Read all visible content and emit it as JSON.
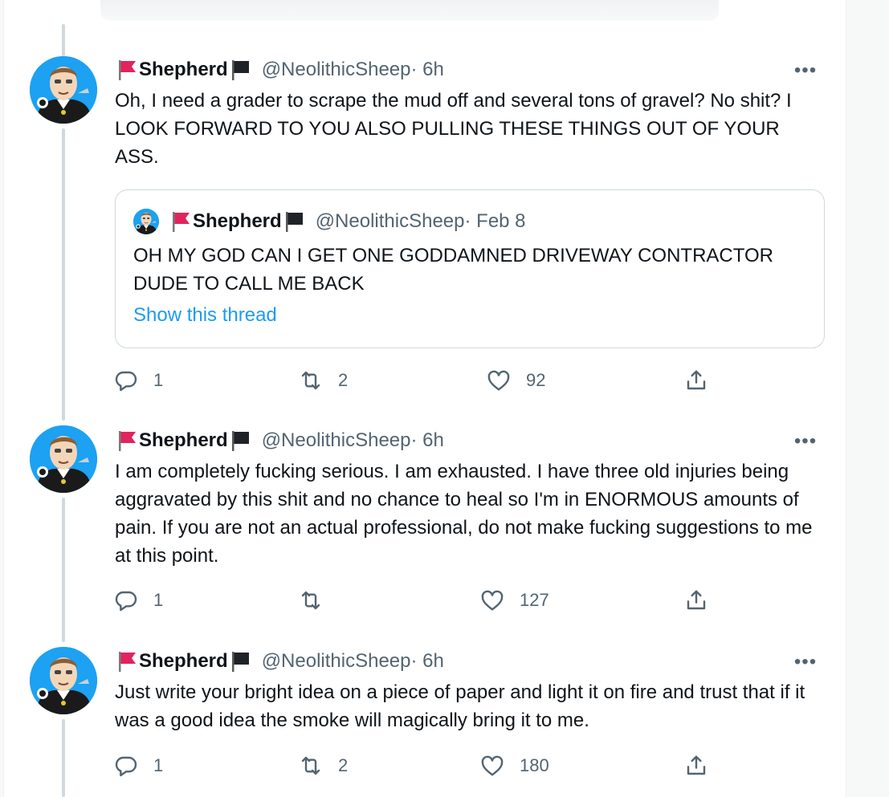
{
  "colors": {
    "accent": "#1d9bf0",
    "text": "#0f1419",
    "muted": "#536471",
    "border": "#cfd9de"
  },
  "tweets": [
    {
      "name": "Shepherd",
      "handle": "@NeolithicSheep",
      "dot_time": " · 6h",
      "text": "Oh, I need a grader to scrape the mud off and several tons of gravel? No shit? I LOOK FORWARD TO YOU ALSO PULLING THESE THINGS OUT OF YOUR ASS.",
      "quote": {
        "name": "Shepherd",
        "handle": "@NeolithicSheep",
        "dot_time": " · Feb 8",
        "text": "OH MY GOD CAN I GET ONE GODDAMNED DRIVEWAY CONTRACTOR DUDE TO CALL ME BACK",
        "link": "Show this thread"
      },
      "replies": "1",
      "retweets": "2",
      "likes": "92"
    },
    {
      "name": "Shepherd",
      "handle": "@NeolithicSheep",
      "dot_time": " · 6h",
      "text": "I am completely fucking serious. I am exhausted. I have three old injuries being aggravated by this shit and no chance to heal so I'm in ENORMOUS amounts of pain. If you are not an actual professional, do not make fucking suggestions to me at this point.",
      "replies": "1",
      "retweets": "",
      "likes": "127"
    },
    {
      "name": "Shepherd",
      "handle": "@NeolithicSheep",
      "dot_time": " · 6h",
      "text": "Just write your bright idea on a piece of paper and light it on fire and trust that if it was a good idea the smoke will magically bring it to me.",
      "replies": "1",
      "retweets": "2",
      "likes": "180"
    }
  ]
}
